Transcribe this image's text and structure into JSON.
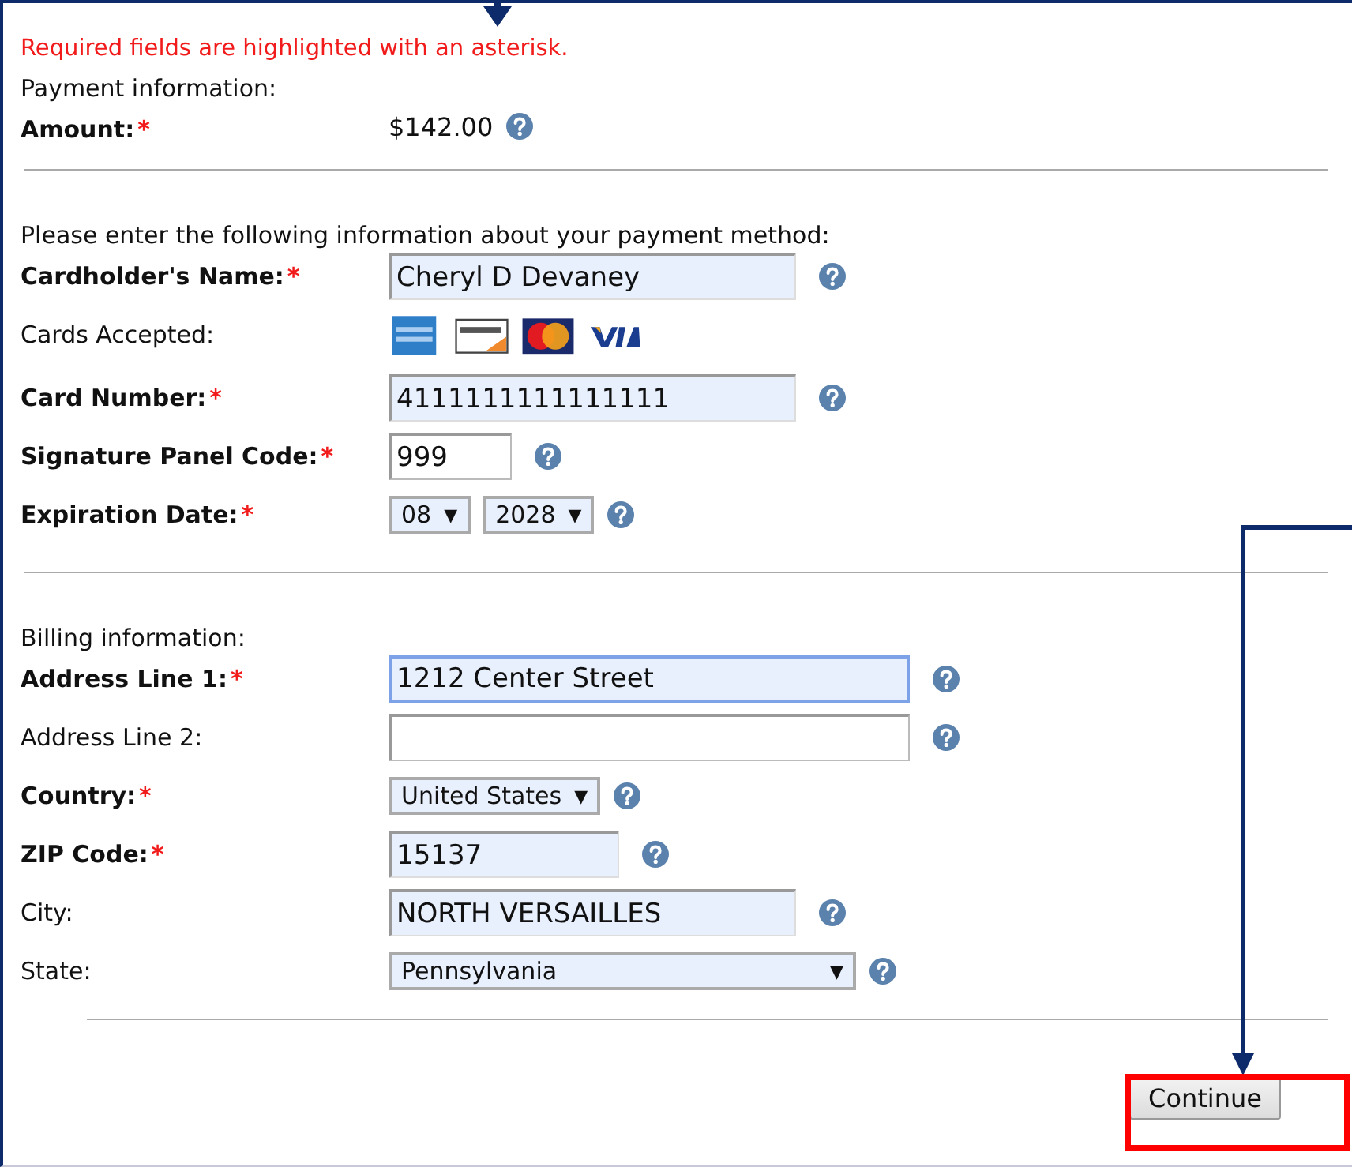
{
  "notice": "Required fields are highlighted with an asterisk.",
  "sections": [
    {
      "heading": "Payment information:",
      "rows": [
        {
          "kind": "static",
          "label": "Amount:",
          "marker": "*",
          "value": "$142.00"
        }
      ]
    },
    {
      "heading": "Please enter the following information about your payment method:",
      "rows": [
        {
          "kind": "text",
          "label": "Cardholder's Name:",
          "marker": "*",
          "value": "Cheryl D Devaney",
          "autofilled": true,
          "focused": false
        },
        {
          "kind": "cards",
          "label": "Cards Accepted:",
          "cards": [
            {
              "kind": "amex"
            },
            {
              "kind": "discover"
            },
            {
              "kind": "mastercard"
            },
            {
              "kind": "visa"
            }
          ]
        },
        {
          "kind": "text",
          "label": "Card Number:",
          "marker": "*",
          "value": "4111111111111111",
          "autofilled": true,
          "focused": false
        },
        {
          "kind": "text",
          "label": "Signature Panel Code:",
          "marker": "*",
          "value": "999",
          "autofilled": false,
          "focused": false
        },
        {
          "kind": "selects",
          "label": "Expiration Date:",
          "marker": "*",
          "selects": [
            {
              "value": "08",
              "caret": "▼"
            },
            {
              "value": "2028",
              "caret": "▼"
            }
          ]
        }
      ]
    },
    {
      "heading": "Billing information:",
      "rows": [
        {
          "kind": "text",
          "label": "Address Line 1:",
          "marker": "*",
          "value": "1212 Center Street",
          "autofilled": true,
          "focused": true
        },
        {
          "kind": "text",
          "label": "Address Line 2:",
          "autofilled": false,
          "focused": false
        },
        {
          "kind": "selects",
          "label": "Country:",
          "marker": "*",
          "selects": [
            {
              "value": "United States",
              "caret": "▼"
            }
          ]
        },
        {
          "kind": "text",
          "label": "ZIP Code:",
          "marker": "*",
          "value": "15137",
          "autofilled": true,
          "focused": false
        },
        {
          "kind": "text",
          "label": "City:",
          "value": "NORTH VERSAILLES",
          "autofilled": true,
          "focused": false
        },
        {
          "kind": "selects",
          "label": "State:",
          "selects": [
            {
              "value": "Pennsylvania",
              "caret": "▼"
            }
          ]
        }
      ]
    }
  ],
  "button": {
    "label": "Continue",
    "highlighted": true
  }
}
